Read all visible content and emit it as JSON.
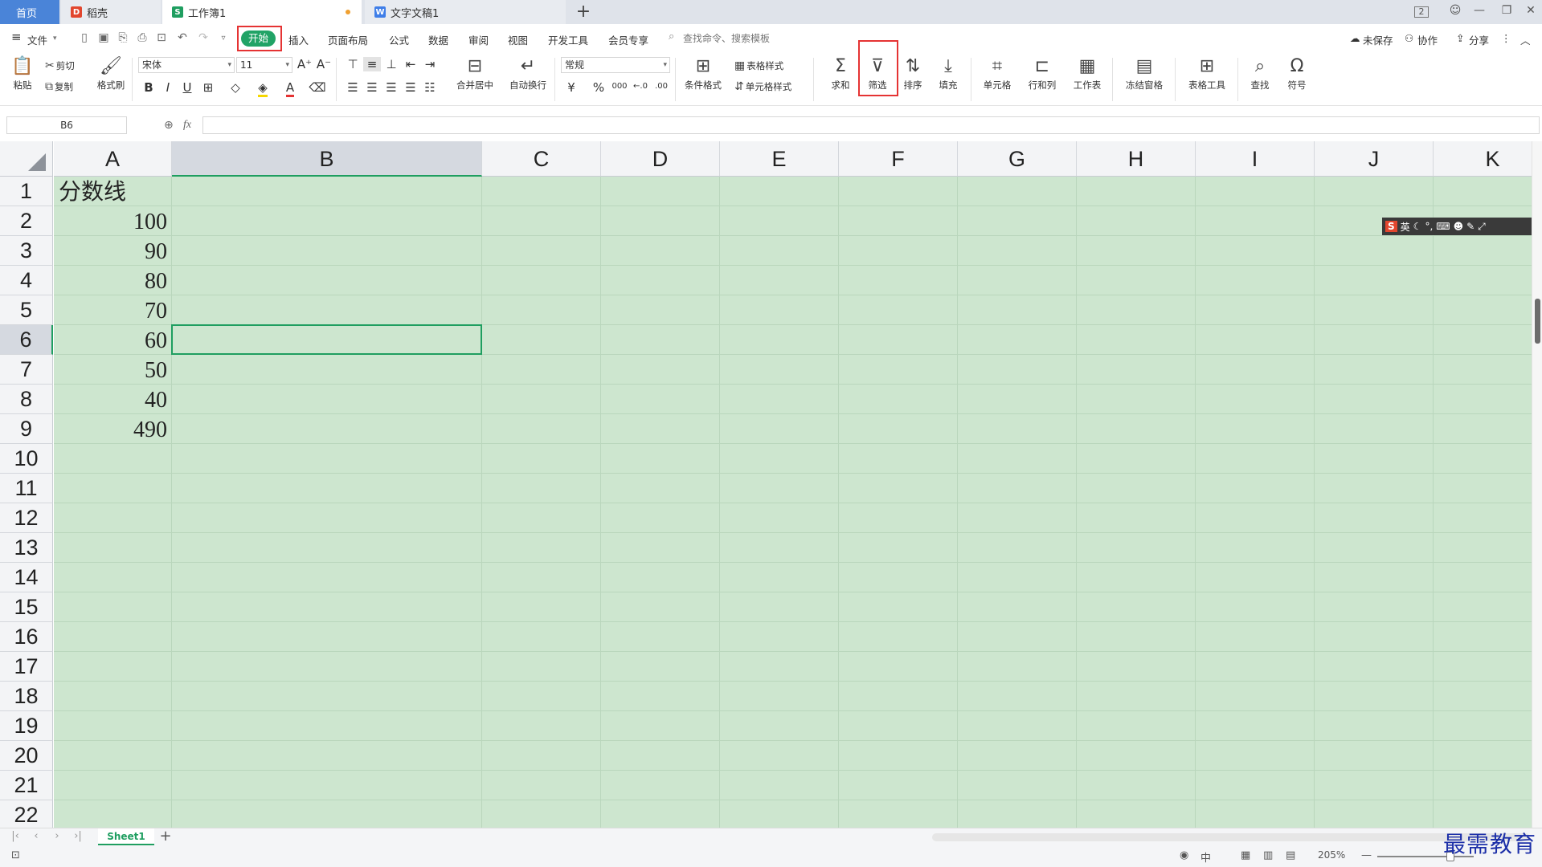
{
  "tabs": {
    "home": "首页",
    "docer": "稻壳",
    "workbook": "工作簿1",
    "writer": "文字文稿1"
  },
  "window_ctl": {
    "num": "2"
  },
  "menu": {
    "file": "文件",
    "items": [
      "开始",
      "插入",
      "页面布局",
      "公式",
      "数据",
      "审阅",
      "视图",
      "开发工具",
      "会员专享"
    ],
    "search_placeholder": "查找命令、搜索模板",
    "unsaved": "未保存",
    "collab": "协作",
    "share": "分享"
  },
  "ribbon": {
    "paste": "粘贴",
    "cut": "剪切",
    "copy": "复制",
    "format_painter": "格式刷",
    "font_name": "宋体",
    "font_size": "11",
    "merge_center": "合并居中",
    "wrap_text": "自动换行",
    "number_format": "常规",
    "currency_symbol": "¥",
    "percent_symbol": "%",
    "thousands": "000",
    "conditional_format": "条件格式",
    "table_style": "表格样式",
    "cell_style": "单元格样式",
    "sum": "求和",
    "filter": "筛选",
    "sort": "排序",
    "fill": "填充",
    "cell": "单元格",
    "row_col": "行和列",
    "worksheet": "工作表",
    "freeze": "冻结窗格",
    "table_tools": "表格工具",
    "find": "查找",
    "symbol": "符号"
  },
  "formula_bar": {
    "name_box": "B6",
    "fx": "fx",
    "value": ""
  },
  "columns": [
    "A",
    "B",
    "C",
    "D",
    "E",
    "F",
    "G",
    "H",
    "I",
    "J",
    "K"
  ],
  "rows": [
    "1",
    "2",
    "3",
    "4",
    "5",
    "6",
    "7",
    "8",
    "9",
    "10",
    "11",
    "12",
    "13",
    "14",
    "15",
    "16",
    "17",
    "18",
    "19",
    "20",
    "21",
    "22"
  ],
  "cells": {
    "A1": "分数线",
    "A2": "100",
    "A3": "90",
    "A4": "80",
    "A5": "70",
    "A6": "60",
    "A7": "50",
    "A8": "40",
    "A9": "490"
  },
  "selected_cell": "B6",
  "ime": {
    "logo": "S",
    "mode": "英"
  },
  "sheets": [
    "Sheet1"
  ],
  "status": {
    "zoom": "205%"
  },
  "watermark": "最需教育",
  "colors": {
    "accent": "#1f9e60",
    "grid_fill": "#cde6cf",
    "highlight_box": "#e53333"
  }
}
